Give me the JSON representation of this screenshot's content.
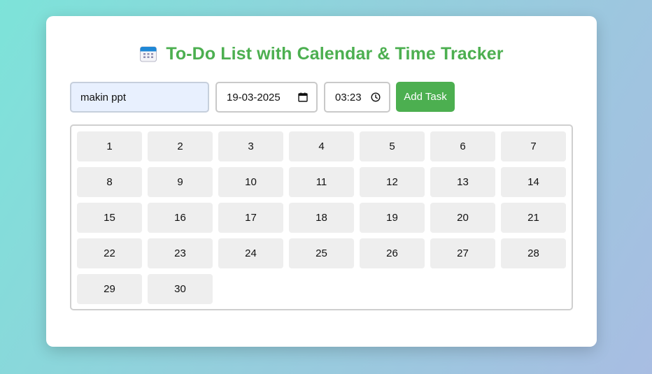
{
  "app": {
    "title": "To-Do List with Calendar & Time Tracker",
    "title_icon": "calendar-icon",
    "accent_color": "#4caf50"
  },
  "form": {
    "task_value": "makin ppt",
    "date_value": "19-03-2025",
    "time_value": "03:23",
    "date_icon": "calendar-picker-icon",
    "time_icon": "clock-icon",
    "add_button_label": "Add Task"
  },
  "calendar": {
    "days": [
      "1",
      "2",
      "3",
      "4",
      "5",
      "6",
      "7",
      "8",
      "9",
      "10",
      "11",
      "12",
      "13",
      "14",
      "15",
      "16",
      "17",
      "18",
      "19",
      "20",
      "21",
      "22",
      "23",
      "24",
      "25",
      "26",
      "27",
      "28",
      "29",
      "30"
    ]
  }
}
